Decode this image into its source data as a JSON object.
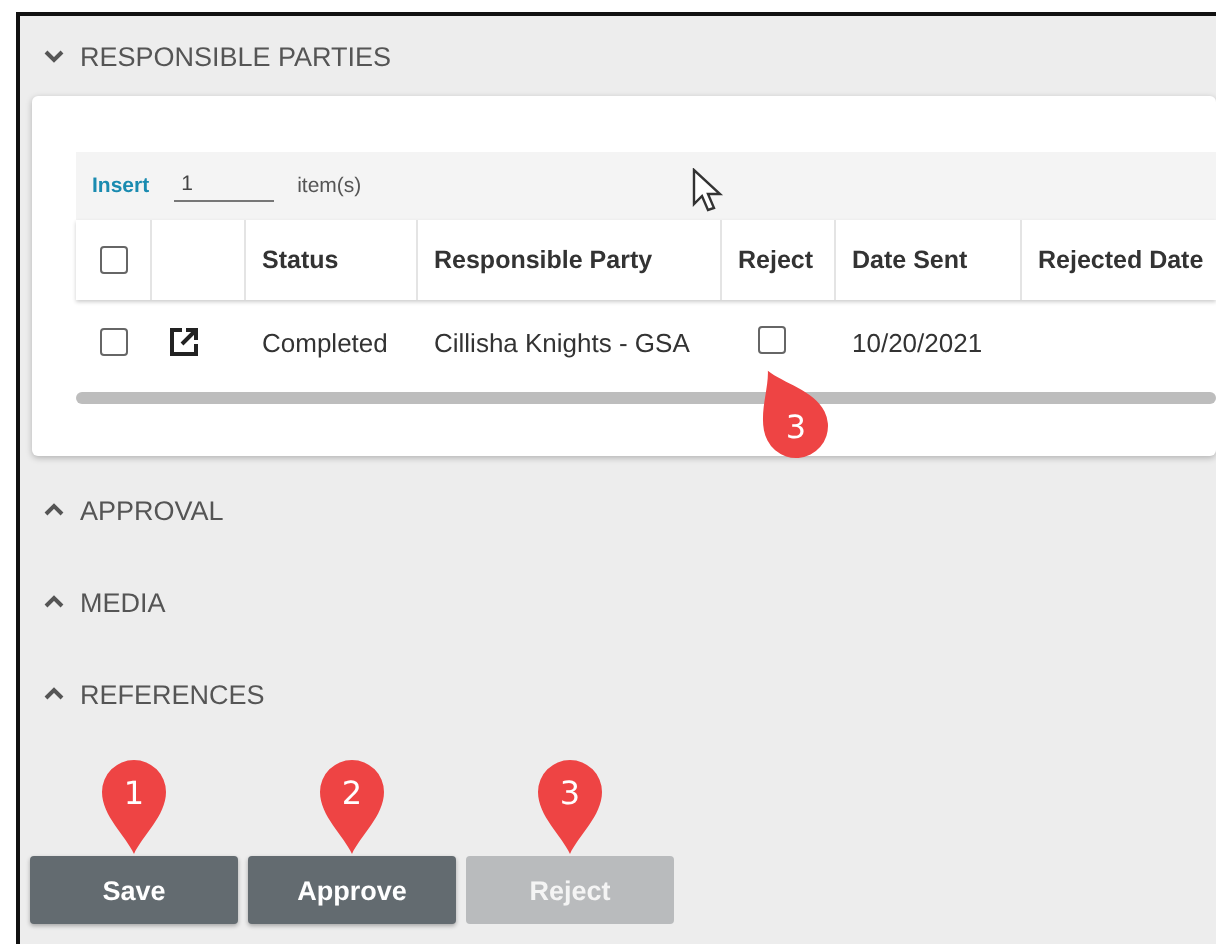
{
  "sections": [
    {
      "title": "RESPONSIBLE PARTIES",
      "expanded": true,
      "grid": {
        "insert_label": "Insert",
        "insert_count": "1",
        "insert_unit": "item(s)",
        "all_checked": false,
        "columns": [
          "Status",
          "Responsible Party",
          "Reject",
          "Date Sent",
          "Rejected Date"
        ],
        "rows": [
          {
            "checked": false,
            "status": "Completed",
            "party": "Cillisha Knights - GSA",
            "reject": false,
            "reject_pin": "3",
            "date_sent": "10/20/2021"
          }
        ]
      }
    },
    {
      "title": "APPROVAL",
      "expanded": false
    },
    {
      "title": "MEDIA",
      "expanded": false
    },
    {
      "title": "REFERENCES",
      "expanded": false
    }
  ],
  "buttons": [
    {
      "label": "Save",
      "disabled": false,
      "pin": "1"
    },
    {
      "label": "Approve",
      "disabled": false,
      "pin": "2"
    },
    {
      "label": "Reject",
      "disabled": true,
      "pin": "3"
    }
  ]
}
